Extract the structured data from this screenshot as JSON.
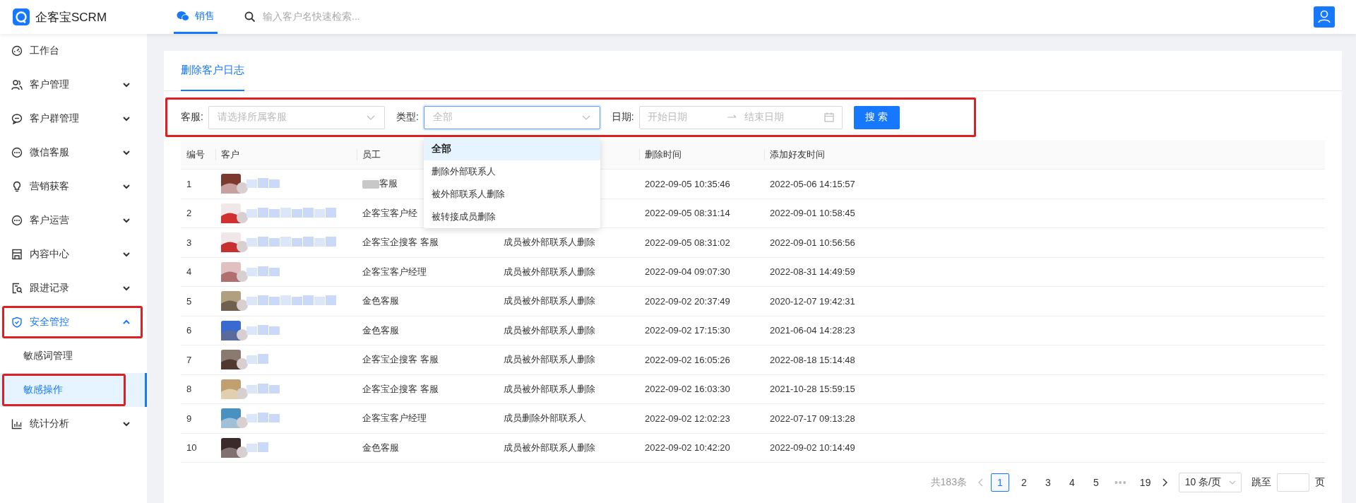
{
  "header": {
    "logo_text": "企客宝SCRM",
    "tabs": [
      {
        "label": "销售",
        "selected": true
      }
    ],
    "search": {
      "placeholder": "输入客户名快速检索..."
    }
  },
  "sidebar": {
    "items": [
      {
        "kind": "link",
        "label": "工作台",
        "highlighted": false
      },
      {
        "kind": "group",
        "label": "客户管理",
        "expanded": false,
        "highlighted": false
      },
      {
        "kind": "group",
        "label": "客户群管理",
        "expanded": false,
        "highlighted": false
      },
      {
        "kind": "group",
        "label": "微信客服",
        "expanded": false,
        "highlighted": false
      },
      {
        "kind": "group",
        "label": "营销获客",
        "expanded": false,
        "highlighted": false
      },
      {
        "kind": "group",
        "label": "客户运营",
        "expanded": false,
        "highlighted": false
      },
      {
        "kind": "group",
        "label": "内容中心",
        "expanded": false,
        "highlighted": false
      },
      {
        "kind": "group",
        "label": "跟进记录",
        "expanded": false,
        "highlighted": false
      },
      {
        "kind": "group",
        "label": "安全管控",
        "expanded": true,
        "highlighted": true,
        "children": [
          {
            "label": "敏感词管理",
            "selected": false,
            "highlighted": false
          },
          {
            "label": "敏感操作",
            "selected": true,
            "highlighted": true
          }
        ]
      },
      {
        "kind": "group",
        "label": "统计分析",
        "expanded": false,
        "highlighted": false
      }
    ]
  },
  "page_tabs": [
    {
      "label": "删除客户日志",
      "selected": true
    }
  ],
  "filters": {
    "highlighted": true,
    "fields": [
      {
        "kind": "select",
        "label": "客服:",
        "placeholder": "请选择所属客服",
        "focused": false
      },
      {
        "kind": "select",
        "label": "类型:",
        "placeholder": "全部",
        "focused": true,
        "options": [
          {
            "label": "全部",
            "selected": true
          },
          {
            "label": "删除外部联系人",
            "selected": false
          },
          {
            "label": "被外部联系人删除",
            "selected": false
          },
          {
            "label": "被转接成员删除",
            "selected": false
          }
        ]
      },
      {
        "kind": "daterange",
        "label": "日期:",
        "start_placeholder": "开始日期",
        "end_placeholder": "结束日期"
      }
    ],
    "search_button": "搜 索"
  },
  "table": {
    "columns": {
      "no": "编号",
      "customer": "客户",
      "staff": "员工",
      "deleted_at": "删除时间",
      "added_at": "添加好友时间"
    },
    "rows": [
      {
        "no": "1",
        "staff": "客服",
        "staff_redacted": true,
        "deleted_at": "2022-09-05 10:35:46",
        "added_at": "2022-05-06 14:15:57"
      },
      {
        "no": "2",
        "staff": "企客宝客户经",
        "staff_redacted": false,
        "deleted_at": "2022-09-05 08:31:14",
        "added_at": "2022-09-01 10:58:45"
      },
      {
        "no": "3",
        "staff": "企客宝企搜客 客服",
        "staff_redacted": false,
        "type": "成员被外部联系人删除",
        "deleted_at": "2022-09-05 08:31:02",
        "added_at": "2022-09-01 10:56:56"
      },
      {
        "no": "4",
        "staff": "企客宝客户经理",
        "staff_redacted": false,
        "type": "成员被外部联系人删除",
        "deleted_at": "2022-09-04 09:07:30",
        "added_at": "2022-08-31 14:49:59"
      },
      {
        "no": "5",
        "staff": "金色客服",
        "staff_redacted": false,
        "type": "成员被外部联系人删除",
        "deleted_at": "2022-09-02 20:37:49",
        "added_at": "2020-12-07 19:42:31"
      },
      {
        "no": "6",
        "staff": "金色客服",
        "staff_redacted": false,
        "type": "成员被外部联系人删除",
        "deleted_at": "2022-09-02 17:15:30",
        "added_at": "2021-06-04 14:28:23"
      },
      {
        "no": "7",
        "staff": "企客宝企搜客 客服",
        "staff_redacted": false,
        "type": "成员被外部联系人删除",
        "deleted_at": "2022-09-02 16:05:26",
        "added_at": "2022-08-18 15:14:48"
      },
      {
        "no": "8",
        "staff": "企客宝企搜客 客服",
        "staff_redacted": false,
        "type": "成员被外部联系人删除",
        "deleted_at": "2022-09-02 16:03:30",
        "added_at": "2021-10-28 15:59:15"
      },
      {
        "no": "9",
        "staff": "企客宝客户经理",
        "staff_redacted": false,
        "type": "成员删除外部联系人",
        "deleted_at": "2022-09-02 12:02:23",
        "added_at": "2022-07-17 09:13:28"
      },
      {
        "no": "10",
        "staff": "金色客服",
        "staff_redacted": false,
        "type": "成员被外部联系人删除",
        "deleted_at": "2022-09-02 10:42:20",
        "added_at": "2022-09-02 10:14:49"
      }
    ]
  },
  "pagination": {
    "total": "共183条",
    "prev_disabled": true,
    "pages": [
      {
        "kind": "page",
        "label": "1",
        "selected": true
      },
      {
        "kind": "page",
        "label": "2",
        "selected": false
      },
      {
        "kind": "page",
        "label": "3",
        "selected": false
      },
      {
        "kind": "page",
        "label": "4",
        "selected": false
      },
      {
        "kind": "page",
        "label": "5",
        "selected": false
      },
      {
        "kind": "ellipsis",
        "label": "•••"
      },
      {
        "kind": "page",
        "label": "19",
        "selected": false
      }
    ],
    "page_size": "10 条/页",
    "jump_label": "跳至",
    "page_suffix": "页"
  }
}
